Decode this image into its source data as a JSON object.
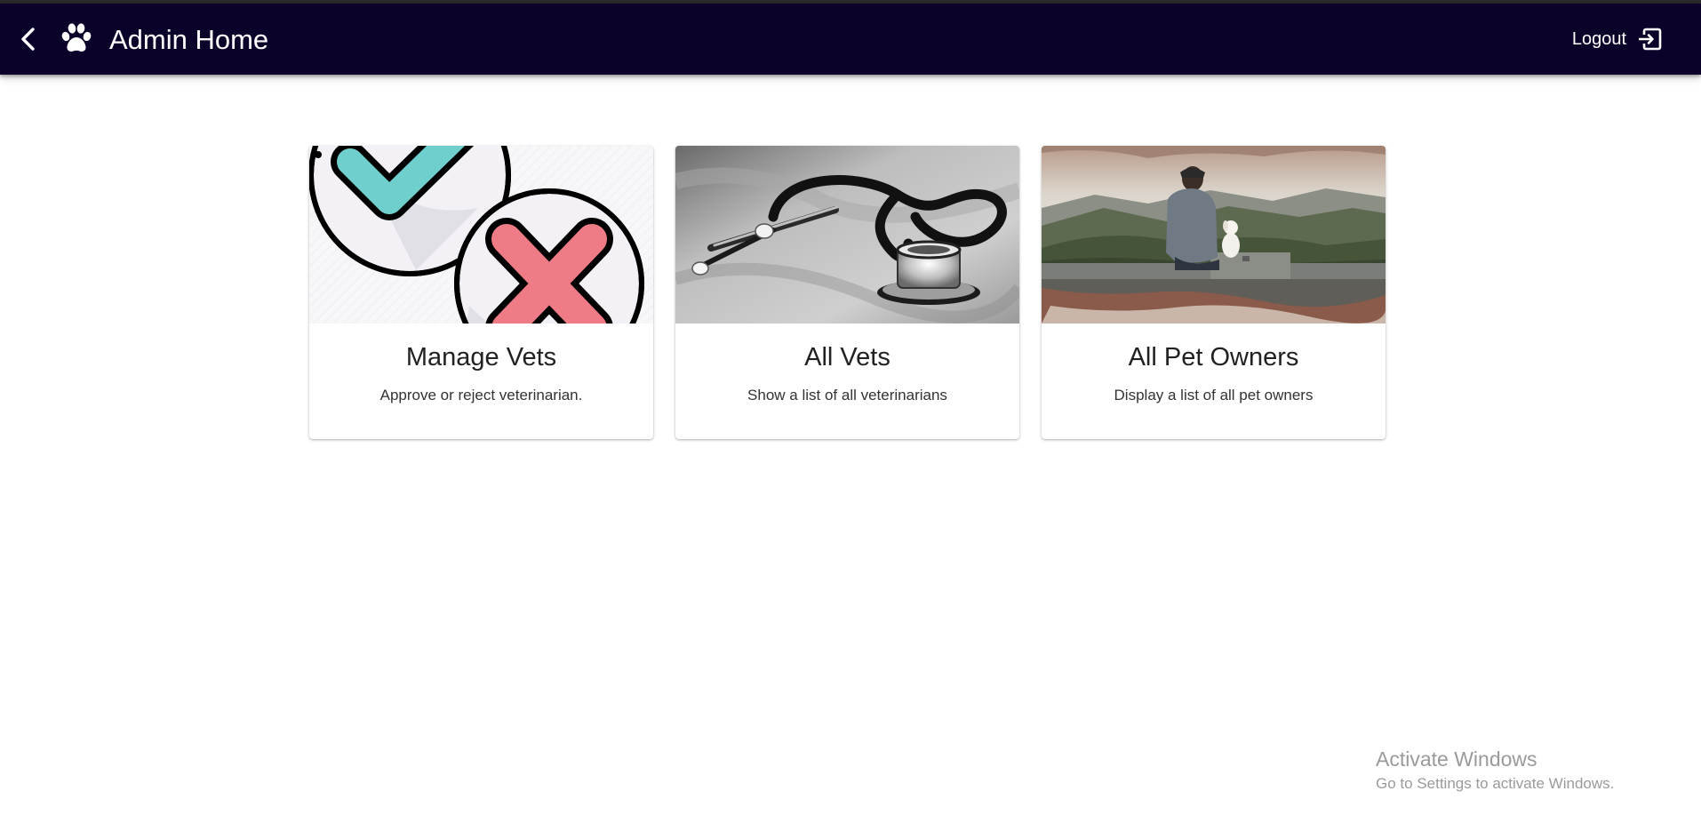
{
  "header": {
    "title": "Admin Home",
    "logout_label": "Logout",
    "background": "#0c0229",
    "icons": {
      "back": "chevron-left-icon",
      "logo": "paw-icon",
      "logout": "exit-icon"
    }
  },
  "cards": [
    {
      "title": "Manage Vets",
      "description": "Approve or reject veterinarian.",
      "image": "approve-reject-illustration"
    },
    {
      "title": "All Vets",
      "description": "Show a list of all veterinarians",
      "image": "stethoscope-photo"
    },
    {
      "title": "All Pet Owners",
      "description": "Display a list of all pet owners",
      "image": "man-with-dog-photo"
    }
  ],
  "watermark": {
    "title": "Activate Windows",
    "subtitle": "Go to Settings to activate Windows."
  }
}
